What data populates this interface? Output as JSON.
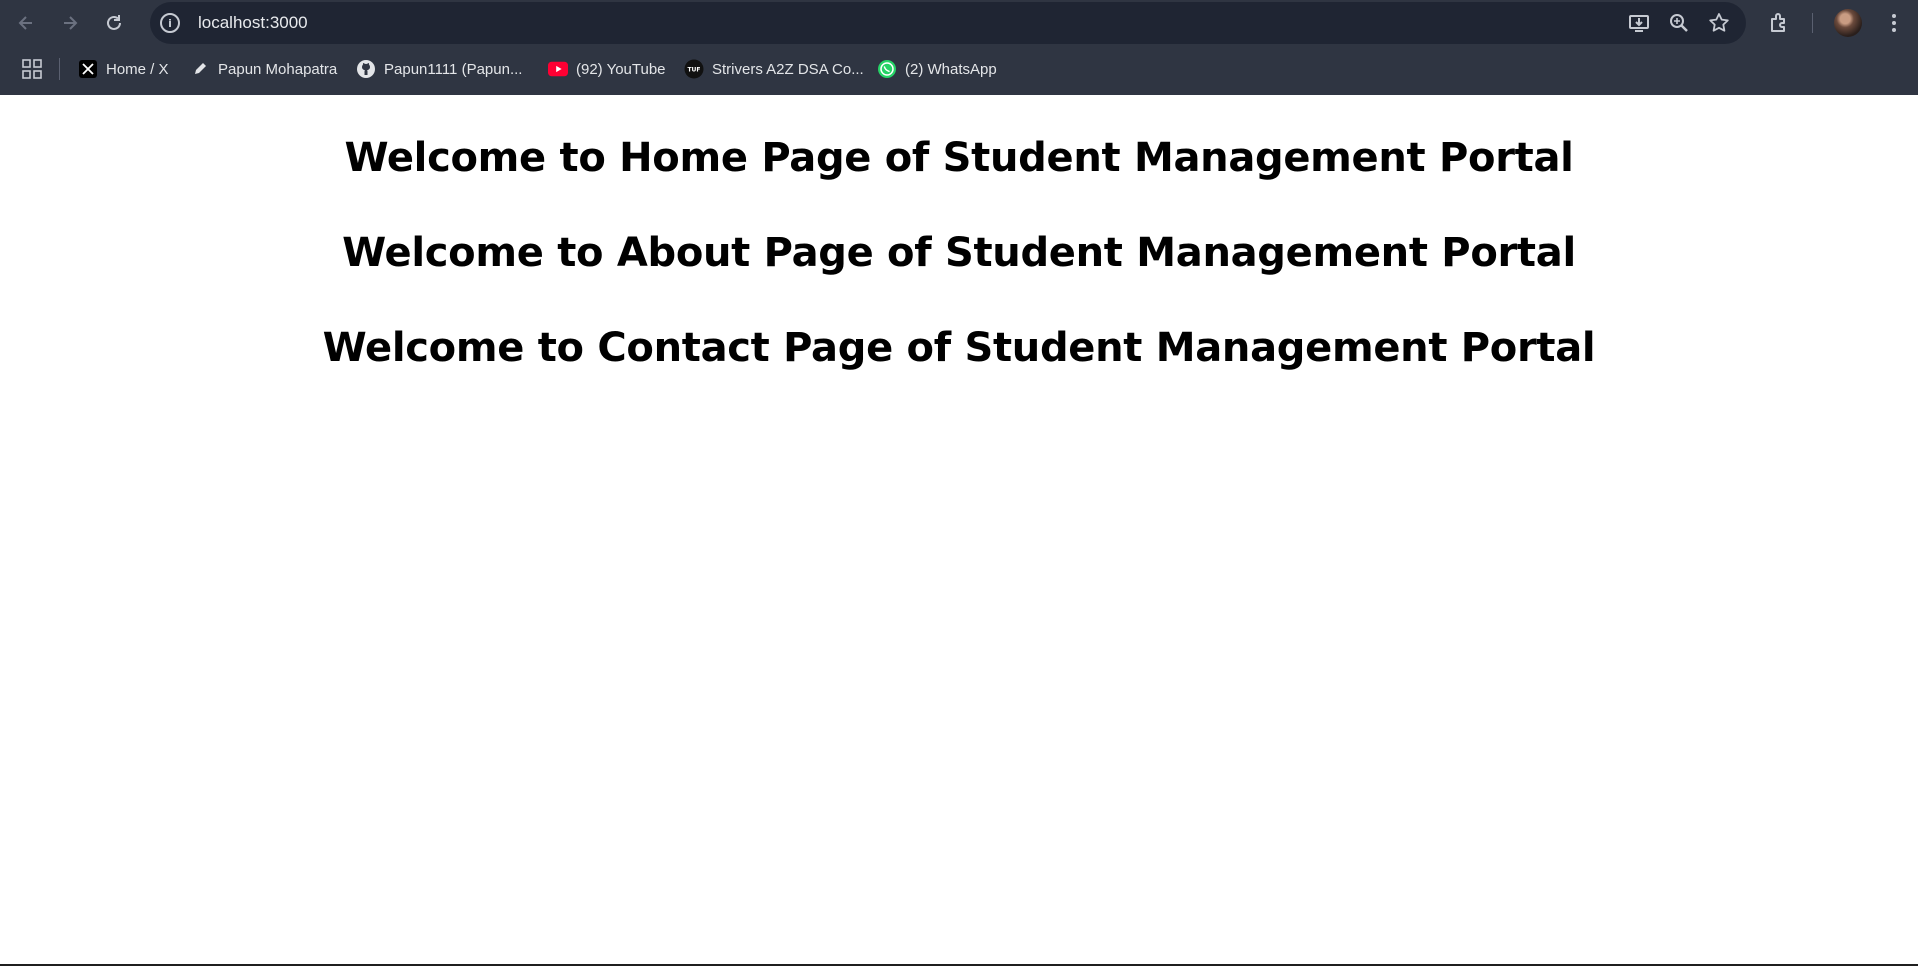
{
  "browser": {
    "url": "localhost:3000",
    "nav": {
      "back": "back-arrow",
      "forward": "forward-arrow",
      "reload": "reload"
    },
    "omnibox_icons": [
      "install-app-icon",
      "zoom-icon",
      "bookmark-star-icon"
    ],
    "toolbar_icons": [
      "extensions-icon",
      "profile-avatar",
      "menu-icon"
    ],
    "colors": {
      "chrome_bg": "#2f3542",
      "omnibox_bg": "#1f2533",
      "youtube_red": "#ff0033",
      "whatsapp_green": "#25d366"
    }
  },
  "bookmarks": [
    {
      "label": "Home / X",
      "icon": "x-logo-icon"
    },
    {
      "label": "Papun Mohapatra",
      "icon": "pen-nib-icon"
    },
    {
      "label": "Papun1111 (Papun...",
      "icon": "github-icon"
    },
    {
      "label": "(92) YouTube",
      "icon": "youtube-icon"
    },
    {
      "label": "Strivers A2Z DSA Co...",
      "icon": "tuf-icon"
    },
    {
      "label": "(2) WhatsApp",
      "icon": "whatsapp-icon"
    }
  ],
  "page": {
    "headings": [
      "Welcome to Home Page of Student Management Portal",
      "Welcome to About Page of Student Management Portal",
      "Welcome to Contact Page of Student Management Portal"
    ]
  }
}
